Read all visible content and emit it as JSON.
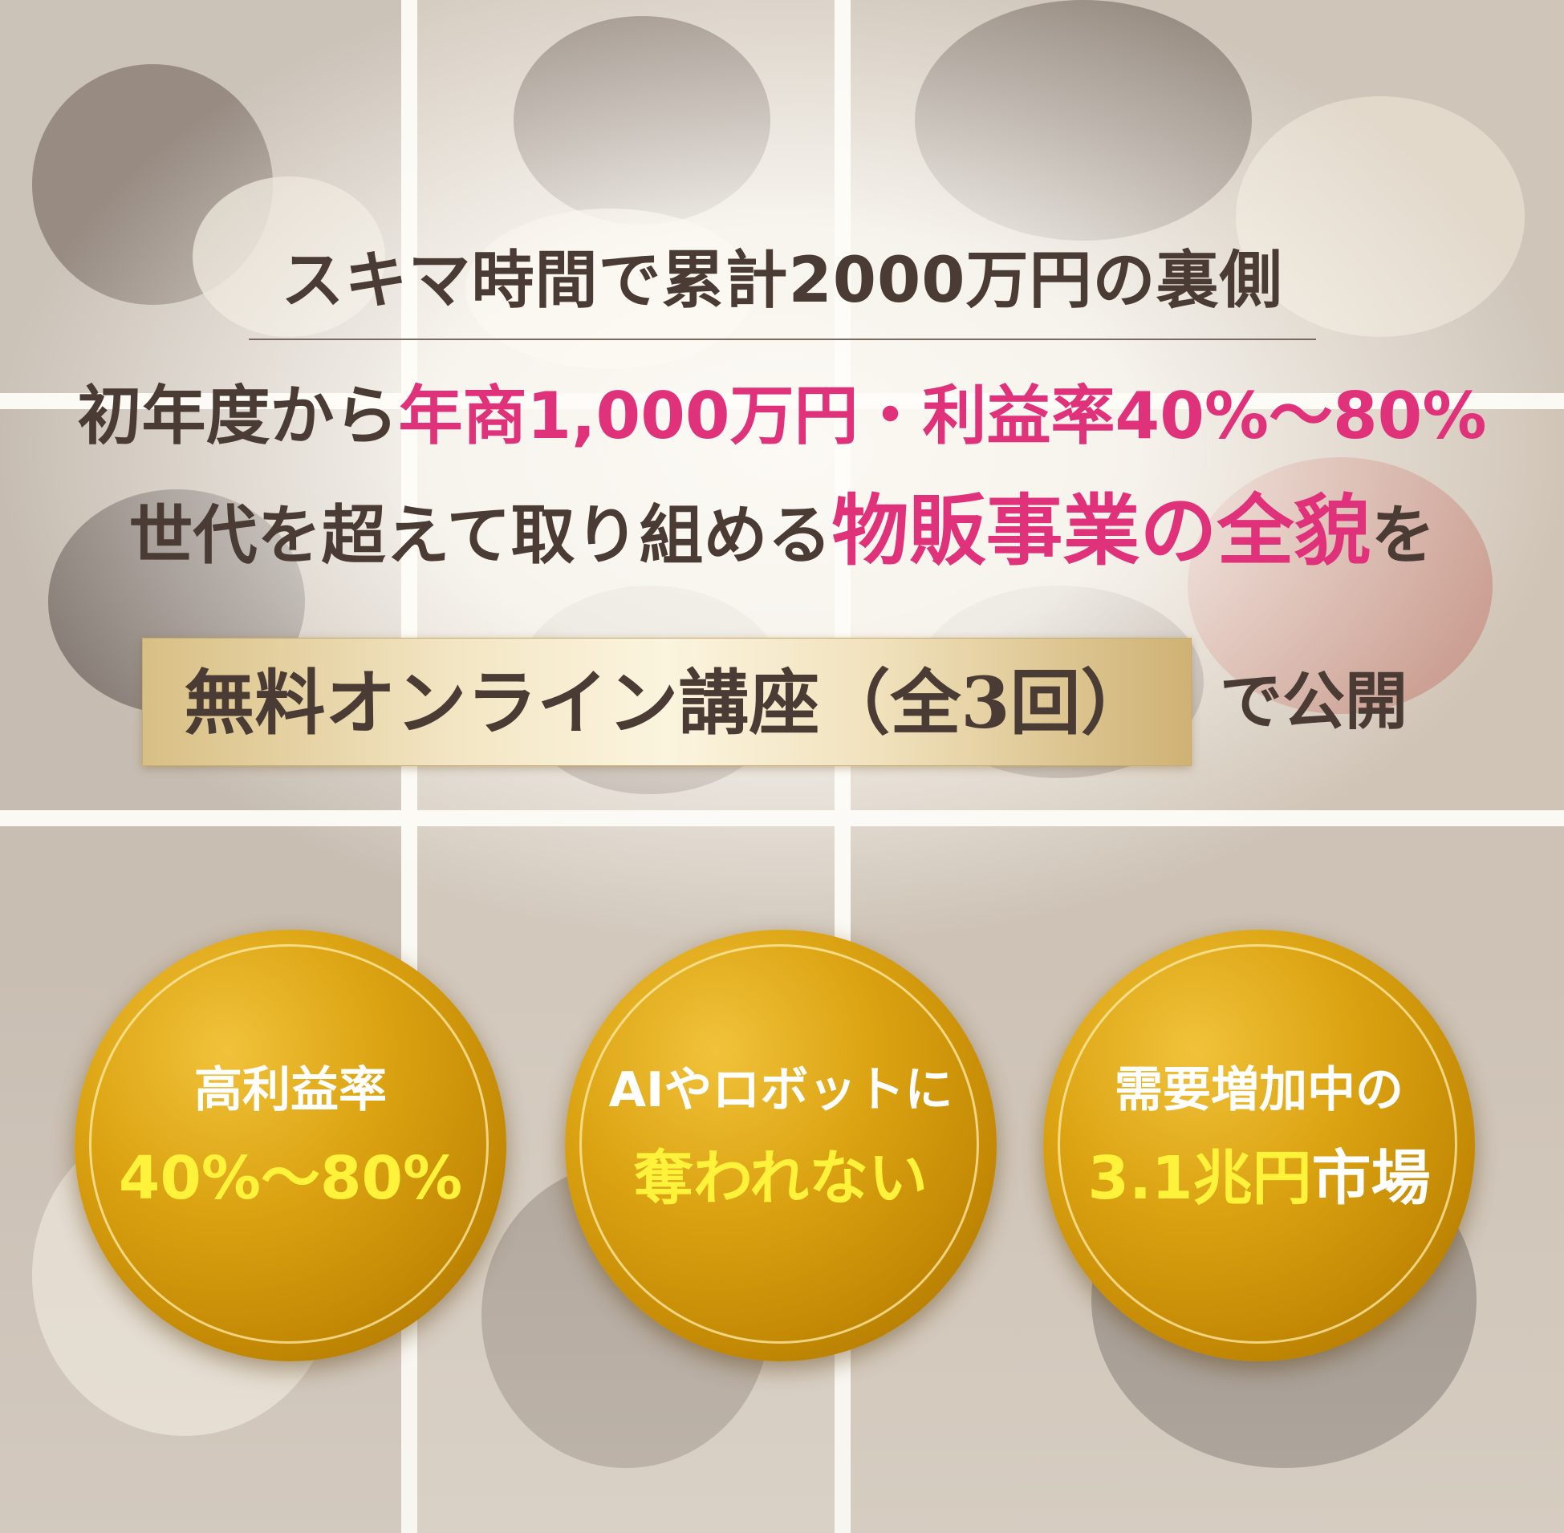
{
  "headline": {
    "line1": "スキマ時間で累計2000万円の裏側",
    "line2_prefix": "初年度から",
    "line2_highlight": "年商1,000万円・利益率40%～80%",
    "line3_prefix": "世代を超えて取り組める",
    "line3_highlight": "物販事業の全貌",
    "line3_suffix": "を"
  },
  "label": {
    "box_text": "無料オンライン講座（全3回）",
    "suffix": "で公開"
  },
  "badges": [
    {
      "top": "高利益率",
      "bottom": "40%～80%"
    },
    {
      "top": "AIやロボットに",
      "bottom": "奪われない"
    },
    {
      "top": "需要増加中の",
      "bottom_highlight": "3.1兆円",
      "bottom_rest": "市場"
    }
  ],
  "colors": {
    "text_brown": "#4a3b34",
    "accent_pink": "#e0327a",
    "badge_gold": "#d39c0e",
    "badge_highlight_yellow": "#fff23a"
  }
}
